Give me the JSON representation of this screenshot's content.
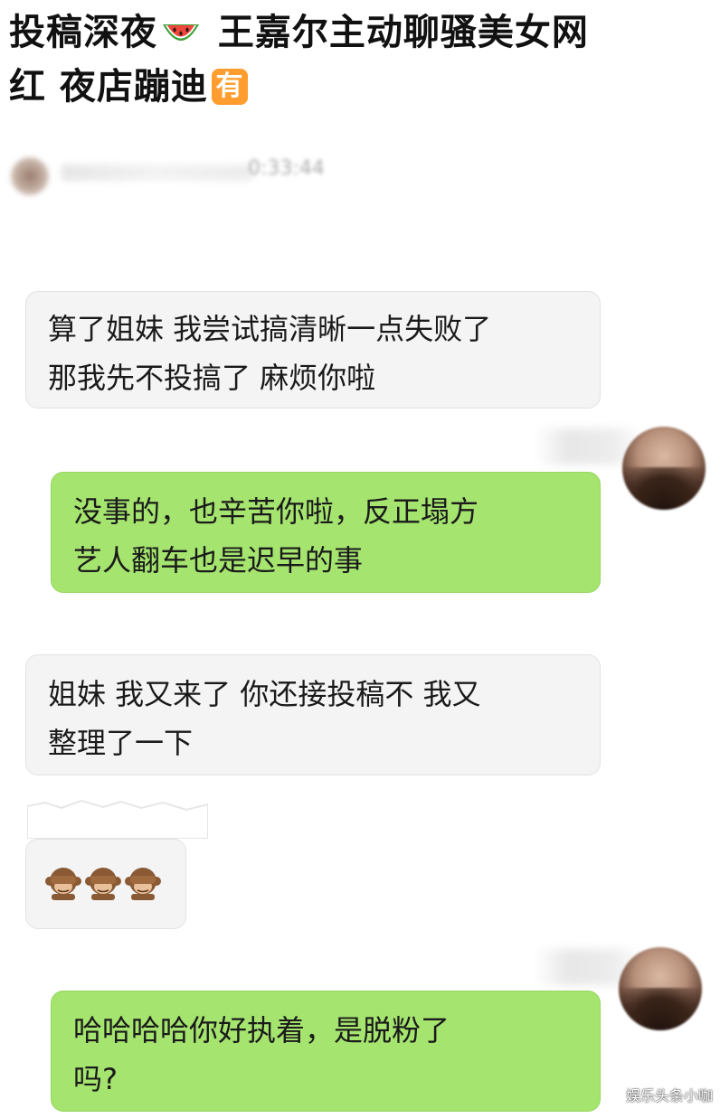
{
  "post": {
    "title_part1": "投稿深夜",
    "title_part2": " 王嘉尔主动聊骚美女网",
    "title_line2": "红 夜店蹦迪",
    "badge": "有",
    "emoji": "watermelon-icon"
  },
  "chat": {
    "header_time": "0:33:44",
    "messages": [
      {
        "side": "incoming",
        "lines": [
          "算了姐妹 我尝试搞清晰一点失败了",
          "那我先不投搞了 麻烦你啦"
        ]
      },
      {
        "side": "outgoing",
        "lines": [
          "没事的，也辛苦你啦，反正塌方",
          "艺人翻车也是迟早的事"
        ]
      },
      {
        "side": "incoming",
        "lines": [
          "姐妹 我又来了 你还接投稿不 我又",
          "整理了一下"
        ]
      },
      {
        "side": "incoming",
        "emoji": "see-no-evil-monkey-icon",
        "count": 3
      },
      {
        "side": "outgoing",
        "lines": [
          "哈哈哈哈你好执着，是脱粉了",
          "吗?"
        ]
      }
    ]
  },
  "watermark": "娱乐头条小咖",
  "colors": {
    "incoming_bubble": "#f4f4f4",
    "outgoing_bubble": "#a5e46f",
    "badge": "#ff9d2e"
  }
}
